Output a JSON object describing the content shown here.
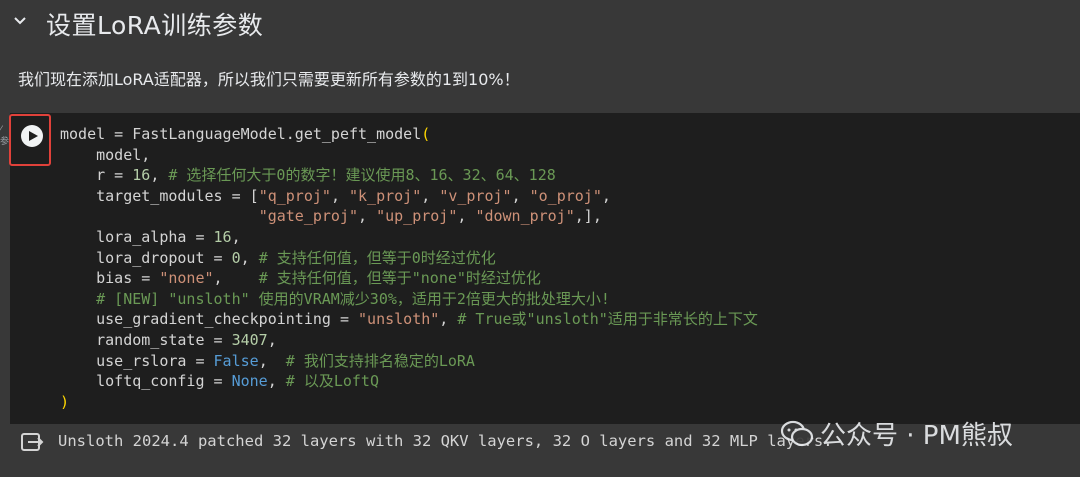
{
  "section": {
    "title": "设置LoRA训练参数"
  },
  "description": "我们现在添加LoRA适配器，所以我们只需要更新所有参数的1到10%！",
  "code": {
    "lines": [
      [
        {
          "t": "model = FastLanguageModel.get_peft_model"
        },
        {
          "t": "(",
          "c": "br"
        }
      ],
      [
        {
          "t": "    model,"
        }
      ],
      [
        {
          "t": "    r = "
        },
        {
          "t": "16",
          "c": "num"
        },
        {
          "t": ", "
        },
        {
          "t": "# 选择任何大于0的数字！建议使用8、16、32、64、128",
          "c": "com"
        }
      ],
      [
        {
          "t": "    target_modules = ["
        },
        {
          "t": "\"q_proj\"",
          "c": "str"
        },
        {
          "t": ", "
        },
        {
          "t": "\"k_proj\"",
          "c": "str"
        },
        {
          "t": ", "
        },
        {
          "t": "\"v_proj\"",
          "c": "str"
        },
        {
          "t": ", "
        },
        {
          "t": "\"o_proj\"",
          "c": "str"
        },
        {
          "t": ","
        }
      ],
      [
        {
          "t": "                      "
        },
        {
          "t": "\"gate_proj\"",
          "c": "str"
        },
        {
          "t": ", "
        },
        {
          "t": "\"up_proj\"",
          "c": "str"
        },
        {
          "t": ", "
        },
        {
          "t": "\"down_proj\"",
          "c": "str"
        },
        {
          "t": ",],"
        }
      ],
      [
        {
          "t": "    lora_alpha = "
        },
        {
          "t": "16",
          "c": "num"
        },
        {
          "t": ","
        }
      ],
      [
        {
          "t": "    lora_dropout = "
        },
        {
          "t": "0",
          "c": "num"
        },
        {
          "t": ", "
        },
        {
          "t": "# 支持任何值，但等于0时经过优化",
          "c": "com"
        }
      ],
      [
        {
          "t": "    bias = "
        },
        {
          "t": "\"none\"",
          "c": "str"
        },
        {
          "t": ",    "
        },
        {
          "t": "# 支持任何值，但等于\"none\"时经过优化",
          "c": "com"
        }
      ],
      [
        {
          "t": "    "
        },
        {
          "t": "# [NEW] \"unsloth\" 使用的VRAM减少30%，适用于2倍更大的批处理大小!",
          "c": "com"
        }
      ],
      [
        {
          "t": "    use_gradient_checkpointing = "
        },
        {
          "t": "\"unsloth\"",
          "c": "str"
        },
        {
          "t": ", "
        },
        {
          "t": "# True或\"unsloth\"适用于非常长的上下文",
          "c": "com"
        }
      ],
      [
        {
          "t": "    random_state = "
        },
        {
          "t": "3407",
          "c": "num"
        },
        {
          "t": ","
        }
      ],
      [
        {
          "t": "    use_rslora = "
        },
        {
          "t": "False",
          "c": "kw"
        },
        {
          "t": ",  "
        },
        {
          "t": "# 我们支持排名稳定的LoRA",
          "c": "com"
        }
      ],
      [
        {
          "t": "    loftq_config = "
        },
        {
          "t": "None",
          "c": "kw"
        },
        {
          "t": ", "
        },
        {
          "t": "# 以及LoftQ",
          "c": "com"
        }
      ],
      [
        {
          "t": ")",
          "c": "br"
        }
      ]
    ]
  },
  "output": "Unsloth 2024.4 patched 32 layers with 32 QKV layers, 32 O layers and 32 MLP layers.",
  "watermark": "公众号 · PM熊叔",
  "icons": {
    "collapse": "chevron-down-icon",
    "run": "play-icon",
    "output": "output-icon",
    "logo": "wechat-icon"
  },
  "colors": {
    "run_highlight": "#e0413a"
  }
}
